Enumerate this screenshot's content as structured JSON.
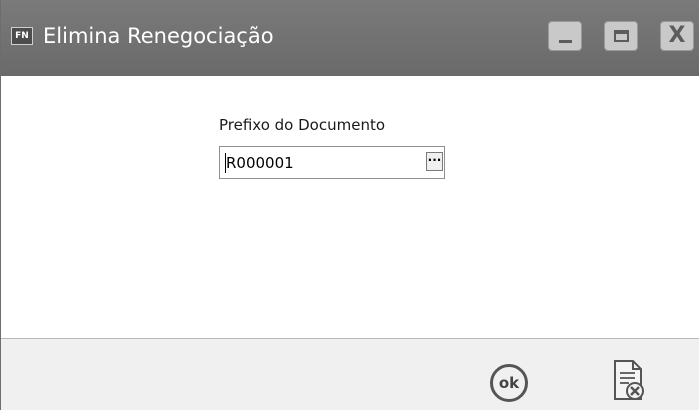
{
  "window": {
    "app_badge": "FN",
    "title": "Elimina Renegociação",
    "controls": {
      "minimize_icon": "minimize-icon",
      "maximize_icon": "maximize-icon",
      "close_icon": "close-icon",
      "close_glyph": "X"
    }
  },
  "form": {
    "prefix_label": "Prefixo do Documento",
    "prefix_value": "R000001",
    "lookup_label": "···"
  },
  "footer": {
    "ok_label": "ok",
    "cancel_icon": "document-cancel-icon"
  },
  "colors": {
    "titlebar": "#737373",
    "footer": "#f0f0f0",
    "content": "#ffffff"
  }
}
